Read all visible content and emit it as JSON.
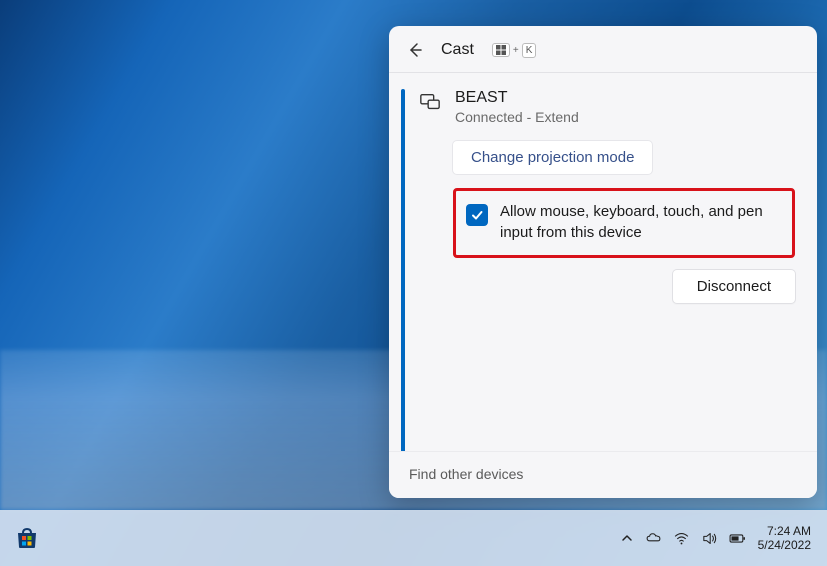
{
  "cast": {
    "title": "Cast",
    "shortcut_key": "K",
    "device": {
      "name": "BEAST",
      "status": "Connected - Extend"
    },
    "change_projection_label": "Change projection mode",
    "allow_input_label": "Allow mouse, keyboard, touch, and pen input from this device",
    "allow_input_checked": true,
    "disconnect_label": "Disconnect",
    "find_other_label": "Find other devices"
  },
  "taskbar": {
    "time": "7:24 AM",
    "date": "5/24/2022"
  }
}
